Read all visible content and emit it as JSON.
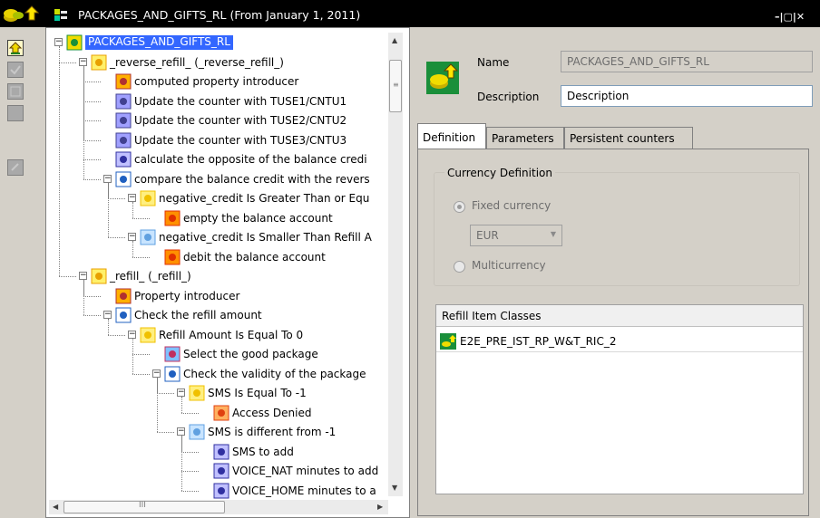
{
  "window": {
    "title": "PACKAGES_AND_GIFTS_RL (From January 1, 2011)",
    "controls": "–|▢|✕"
  },
  "toolbar": {
    "buttons": [
      "up-arrow-icon",
      "check-icon",
      "st-icon",
      "blank-icon",
      "refresh-icon"
    ]
  },
  "tree": {
    "nodes": [
      {
        "label": "PACKAGES_AND_GIFTS_RL",
        "icon": "package-icon"
      },
      {
        "label": "_reverse_refill_ (_reverse_refill_)",
        "icon": "function-icon"
      },
      {
        "label": "computed property introducer",
        "icon": "property-icon"
      },
      {
        "label": "Update the counter with TUSE1/CNTU1",
        "icon": "counter-icon"
      },
      {
        "label": "Update the counter with TUSE2/CNTU2",
        "icon": "counter-icon"
      },
      {
        "label": "Update the counter with TUSE3/CNTU3",
        "icon": "counter-icon"
      },
      {
        "label": "calculate the opposite of the balance credi",
        "icon": "calc-icon"
      },
      {
        "label": "compare the balance credit with the revers",
        "icon": "compare-icon"
      },
      {
        "label": "negative_credit Is Greater Than or Equ",
        "icon": "sun-icon"
      },
      {
        "label": "empty the balance account",
        "icon": "action-icon"
      },
      {
        "label": "negative_credit Is Smaller Than Refill A",
        "icon": "moon-icon"
      },
      {
        "label": "debit the balance account",
        "icon": "action-icon"
      },
      {
        "label": "_refill_ (_refill_)",
        "icon": "function-icon"
      },
      {
        "label": "Property introducer",
        "icon": "property-icon"
      },
      {
        "label": "Check the refill amount",
        "icon": "compare-icon"
      },
      {
        "label": "Refill Amount Is Equal To 0",
        "icon": "sun-icon"
      },
      {
        "label": "Select the good package",
        "icon": "select-icon"
      },
      {
        "label": "Check the validity of the package",
        "icon": "compare-icon"
      },
      {
        "label": "SMS Is Equal To -1",
        "icon": "sun-icon"
      },
      {
        "label": "Access Denied",
        "icon": "deny-icon"
      },
      {
        "label": "SMS is different from -1",
        "icon": "moon-icon"
      },
      {
        "label": "SMS to add",
        "icon": "calc-icon"
      },
      {
        "label": "VOICE_NAT minutes to add",
        "icon": "calc-icon"
      },
      {
        "label": "VOICE_HOME minutes to a",
        "icon": "calc-icon"
      }
    ]
  },
  "scroll": {
    "hthumb_label": "III"
  },
  "details": {
    "name_label": "Name",
    "name_value": "PACKAGES_AND_GIFTS_RL",
    "description_label": "Description",
    "description_value": "Description",
    "tabs": [
      "Definition",
      "Parameters",
      "Persistent counters"
    ],
    "currency": {
      "title": "Currency Definition",
      "fixed_label": "Fixed currency",
      "fixed_selected": true,
      "currency_value": "EUR",
      "multi_label": "Multicurrency"
    },
    "refill_table": {
      "header": "Refill Item Classes",
      "rows": [
        "E2E_PRE_IST_RP_W&T_RIC_2"
      ]
    }
  }
}
